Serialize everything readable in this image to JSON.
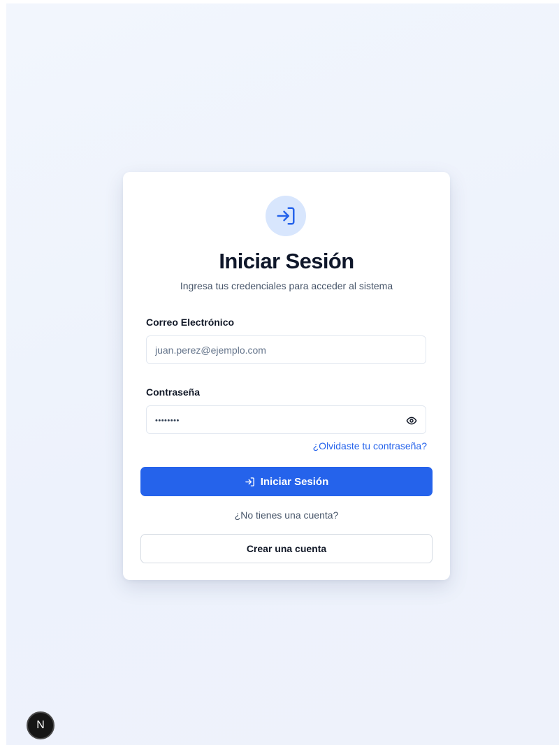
{
  "login": {
    "title": "Iniciar Sesión",
    "subtitle": "Ingresa tus credenciales para acceder al sistema",
    "email_label": "Correo Electrónico",
    "email_placeholder": "juan.perez@ejemplo.com",
    "password_label": "Contraseña",
    "password_masked": "••••••••",
    "forgot_password": "¿Olvidaste tu contraseña?",
    "submit_label": "Iniciar Sesión",
    "no_account": "¿No tienes una cuenta?",
    "create_account": "Crear una cuenta"
  },
  "badge": {
    "letter": "N"
  },
  "icons": {
    "header": "login-icon",
    "submit": "login-icon",
    "password_toggle": "eye-icon"
  },
  "colors": {
    "primary": "#2563eb",
    "icon_bg": "#d8e6fd",
    "title": "#0f172a"
  }
}
